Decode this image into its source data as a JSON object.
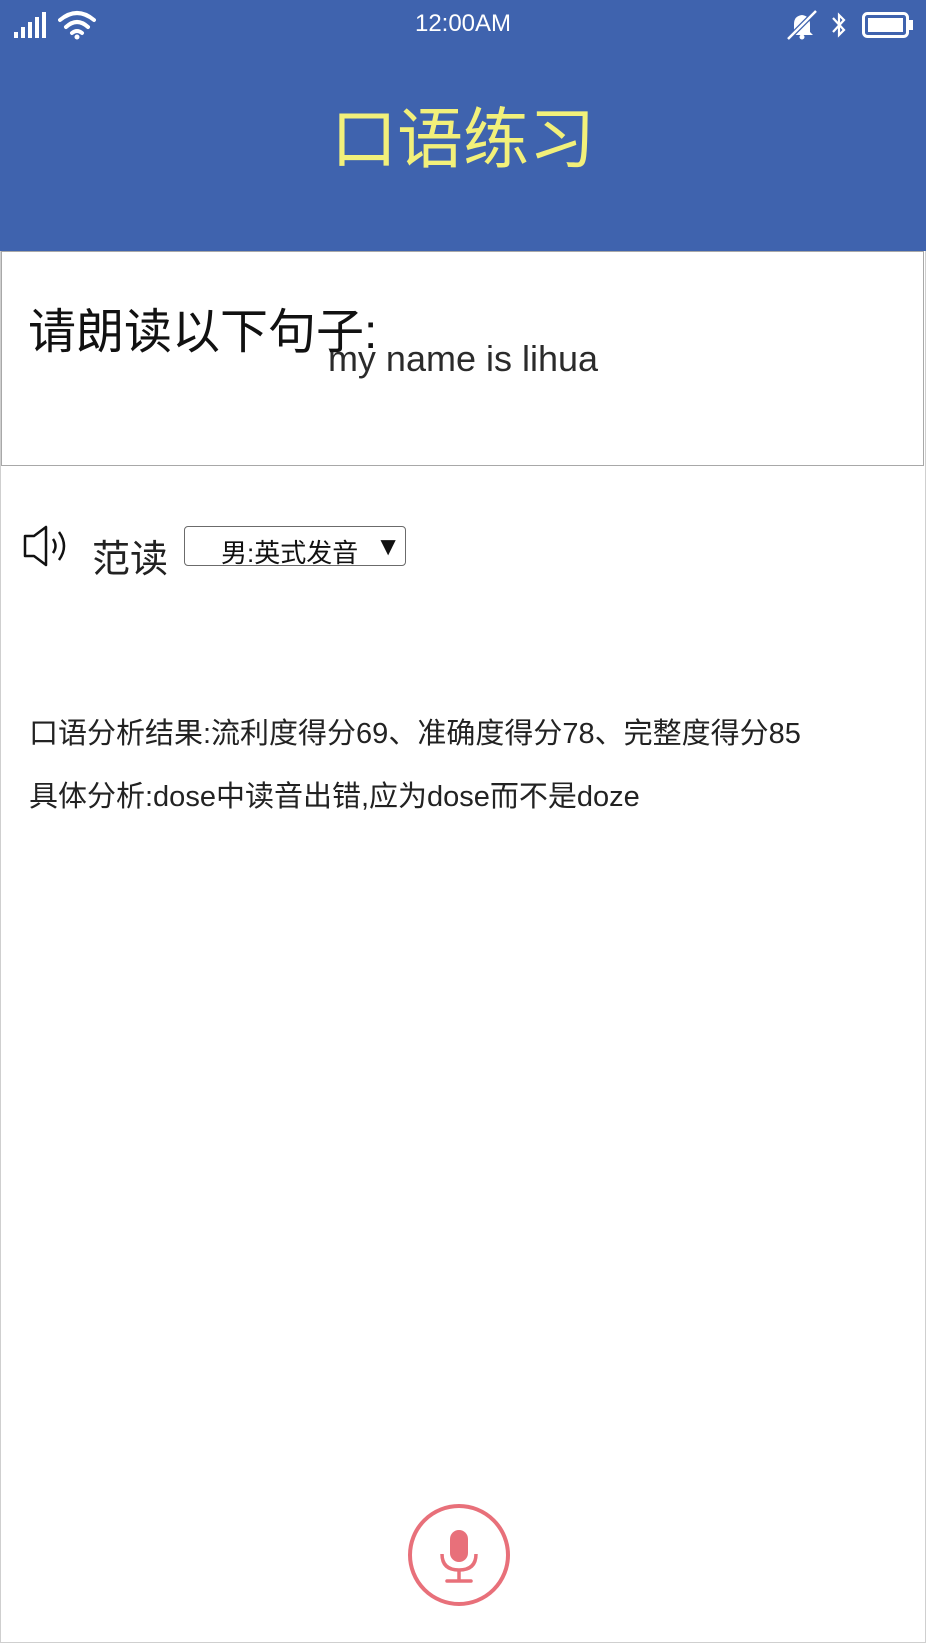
{
  "status_bar": {
    "time": "12:00AM"
  },
  "header": {
    "title": "口语练习"
  },
  "prompt": {
    "label": "请朗读以下句子:",
    "sentence": "my name is lihua"
  },
  "sample_reading": {
    "label": "范读",
    "voice_selected": "男:英式发音",
    "arrow": "▼"
  },
  "analysis": {
    "result": "口语分析结果:流利度得分69、准确度得分78、完整度得分85",
    "detail": "具体分析:dose中读音出错,应为dose而不是doze"
  },
  "colors": {
    "header_bg": "#3f63ae",
    "title": "#f2f07a",
    "mic": "#e8707a"
  },
  "icons": [
    "signal-icon",
    "wifi-icon",
    "mute-icon",
    "bluetooth-icon",
    "battery-icon",
    "speaker-icon",
    "microphone-icon"
  ]
}
